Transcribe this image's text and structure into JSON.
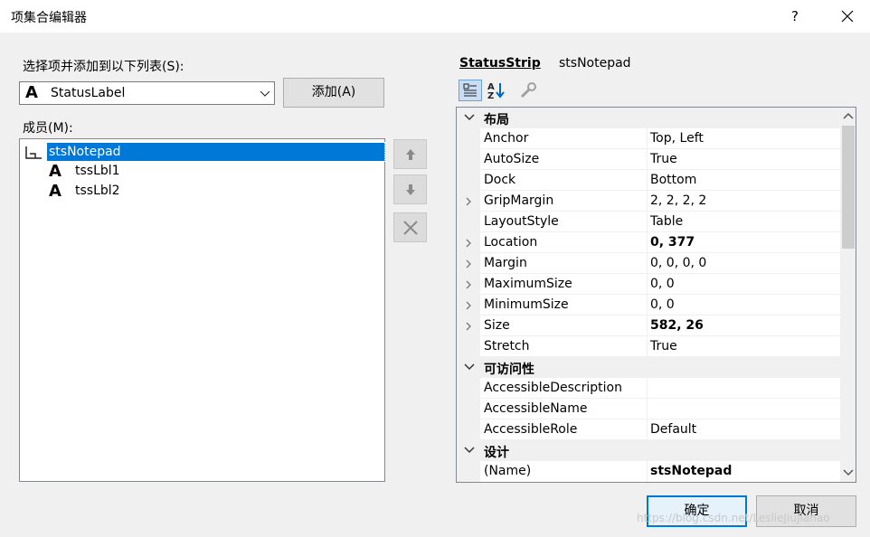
{
  "window": {
    "title": "项集合编辑器",
    "help_glyph": "?"
  },
  "left": {
    "select_label": "选择项并添加到以下列表(S):",
    "combo_glyph": "A",
    "combo_value": "StatusLabel",
    "add_button": "添加(A)",
    "members_label": "成员(M):",
    "members": [
      {
        "label": "stsNotepad",
        "icon": "status-strip-icon",
        "selected": true
      },
      {
        "label": "tssLbl1",
        "icon": "label-icon",
        "glyph": "A"
      },
      {
        "label": "tssLbl2",
        "icon": "label-icon",
        "glyph": "A"
      }
    ]
  },
  "right": {
    "component_type": "StatusStrip",
    "component_name": "stsNotepad",
    "categories": {
      "layout": "布局",
      "accessibility": "可访问性",
      "design": "设计"
    },
    "props": [
      {
        "name": "Anchor",
        "value": "Top, Left"
      },
      {
        "name": "AutoSize",
        "value": "True"
      },
      {
        "name": "Dock",
        "value": "Bottom"
      },
      {
        "name": "GripMargin",
        "value": "2, 2, 2, 2"
      },
      {
        "name": "LayoutStyle",
        "value": "Table"
      },
      {
        "name": "Location",
        "value": "0, 377"
      },
      {
        "name": "Margin",
        "value": "0, 0, 0, 0"
      },
      {
        "name": "MaximumSize",
        "value": "0, 0"
      },
      {
        "name": "MinimumSize",
        "value": "0, 0"
      },
      {
        "name": "Size",
        "value": "582, 26"
      },
      {
        "name": "Stretch",
        "value": "True"
      },
      {
        "name": "AccessibleDescription",
        "value": ""
      },
      {
        "name": "AccessibleName",
        "value": ""
      },
      {
        "name": "AccessibleRole",
        "value": "Default"
      },
      {
        "name": "(Name)",
        "value": "stsNotepad"
      }
    ]
  },
  "footer": {
    "ok_button": "确定",
    "cancel_button": "取消",
    "watermark": "https://blog.csdn.net/LeslieJiuJiahao"
  },
  "colors": {
    "accent": "#0078d7",
    "selection": "#0078d7",
    "dialog_bg": "#f0f0f0"
  }
}
